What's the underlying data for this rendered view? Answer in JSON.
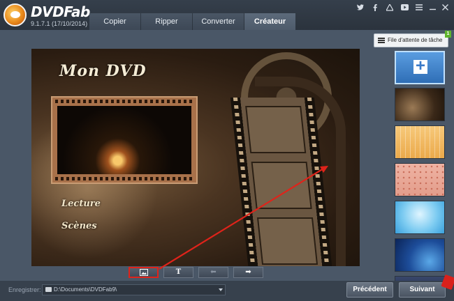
{
  "app": {
    "name": "DVDFab",
    "version": "9.1.7.1 (17/10/2014)"
  },
  "tabs": [
    {
      "label": "Copier",
      "active": false
    },
    {
      "label": "Ripper",
      "active": false
    },
    {
      "label": "Converter",
      "active": false
    },
    {
      "label": "Créateur",
      "active": true
    }
  ],
  "window_controls": [
    "twitter-icon",
    "facebook-icon",
    "web-icon",
    "youtube-icon",
    "menu-icon",
    "minimize-icon",
    "close-icon"
  ],
  "queue": {
    "label": "File d'attente de tâche",
    "count": "1"
  },
  "menu_preview": {
    "title": "Mon DVD",
    "items": [
      "Lecture",
      "Scènes"
    ]
  },
  "toolbar": {
    "buttons": [
      {
        "name": "image-icon",
        "label": "",
        "highlighted": true
      },
      {
        "name": "text-icon",
        "label": "T",
        "highlighted": false
      },
      {
        "name": "arrow-left-icon",
        "label": "⬅",
        "highlighted": false
      },
      {
        "name": "arrow-right-icon",
        "label": "➡",
        "highlighted": false
      }
    ]
  },
  "templates": {
    "add_label": "+",
    "items": [
      "film-brown",
      "grid-yellow",
      "dots-pink",
      "light-blue",
      "deep-blue"
    ]
  },
  "bottom": {
    "save_label": "Enregistrer:",
    "save_path": "D:\\Documents\\DVDFab9\\",
    "prev_label": "Précédent",
    "next_label": "Suivant"
  },
  "colors": {
    "accent_red": "#e0231a",
    "badge_green": "#5fb42c",
    "panel_bg": "#4a5767"
  }
}
